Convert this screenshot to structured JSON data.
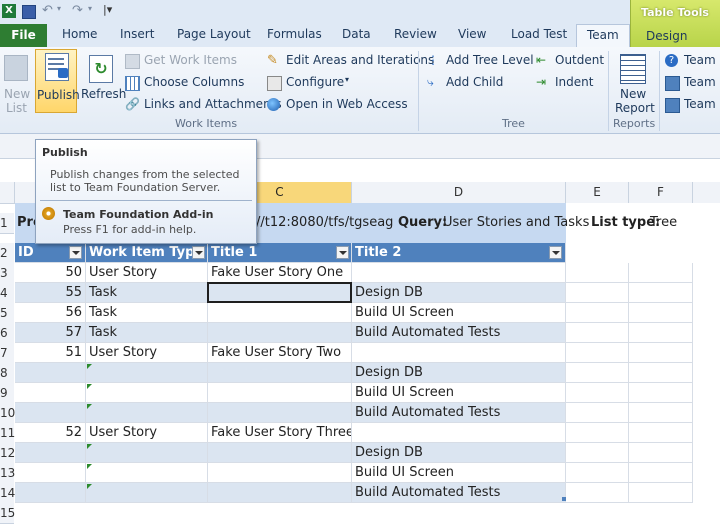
{
  "tabs": {
    "file": "File",
    "items": [
      "Home",
      "Insert",
      "Page Layout",
      "Formulas",
      "Data",
      "Review",
      "View",
      "Load Test",
      "Team",
      "Design"
    ],
    "active": "Team",
    "contextual_group": "Table Tools"
  },
  "ribbon": {
    "new_list": "New\nList",
    "new_list_l1": "New",
    "new_list_l2": "List",
    "publish": "Publish",
    "refresh": "Refresh",
    "get_work_items": "Get Work Items",
    "choose_columns": "Choose Columns",
    "links_and_attachments": "Links and Attachments",
    "edit_areas": "Edit Areas and Iterations",
    "configure": "Configure",
    "open_web_access": "Open in Web Access",
    "group_work_items": "Work Items",
    "add_tree_level": "Add Tree Level",
    "add_child": "Add Child",
    "outdent": "Outdent",
    "indent": "Indent",
    "group_tree": "Tree",
    "new_report_l1": "New",
    "new_report_l2": "Report",
    "group_reports": "Reports",
    "team_items": [
      "Team P",
      "Team P",
      "Team P"
    ]
  },
  "tooltip": {
    "title": "Publish",
    "body_l1": "Publish changes from the selected",
    "body_l2": "list to Team Foundation Server.",
    "addin_title": "Team Foundation Add-in",
    "addin_help": "Press F1 for add-in help."
  },
  "grid": {
    "columns": [
      "C",
      "D",
      "E",
      "F"
    ],
    "selected_column": "C",
    "row_numbers": [
      "1",
      "2",
      "3",
      "4",
      "5",
      "6",
      "7",
      "8",
      "9",
      "10",
      "11",
      "12",
      "13",
      "14",
      "15"
    ],
    "row1": {
      "project_prefix": "Pro",
      "server_fragment": "//t12:8080/tfs/tgseag",
      "query_label": "Query:",
      "query_value": "User Stories and Tasks",
      "list_type_label": "List type:",
      "list_type_value": "Tree"
    },
    "headers": [
      "ID",
      "Work Item Type",
      "Title 1",
      "Title 2"
    ],
    "rows": [
      {
        "id": "50",
        "type": "User Story",
        "title1": "Fake User Story One",
        "title2": ""
      },
      {
        "id": "55",
        "type": "Task",
        "title1": "",
        "title2": "Design DB"
      },
      {
        "id": "56",
        "type": "Task",
        "title1": "",
        "title2": "Build UI Screen"
      },
      {
        "id": "57",
        "type": "Task",
        "title1": "",
        "title2": "Build Automated Tests"
      },
      {
        "id": "51",
        "type": "User Story",
        "title1": "Fake User Story Two",
        "title2": ""
      },
      {
        "id": "",
        "type": "",
        "title1": "",
        "title2": "Design DB"
      },
      {
        "id": "",
        "type": "",
        "title1": "",
        "title2": "Build UI Screen"
      },
      {
        "id": "",
        "type": "",
        "title1": "",
        "title2": "Build Automated Tests"
      },
      {
        "id": "52",
        "type": "User Story",
        "title1": "Fake User Story Three",
        "title2": ""
      },
      {
        "id": "",
        "type": "",
        "title1": "",
        "title2": "Design DB"
      },
      {
        "id": "",
        "type": "",
        "title1": "",
        "title2": "Build UI Screen"
      },
      {
        "id": "",
        "type": "",
        "title1": "",
        "title2": "Build Automated Tests"
      }
    ]
  },
  "colors": {
    "header_blue": "#4f81bd",
    "band_blue": "#dbe5f1",
    "file_green": "#2e7d32",
    "selected_col": "#f8d77a"
  }
}
